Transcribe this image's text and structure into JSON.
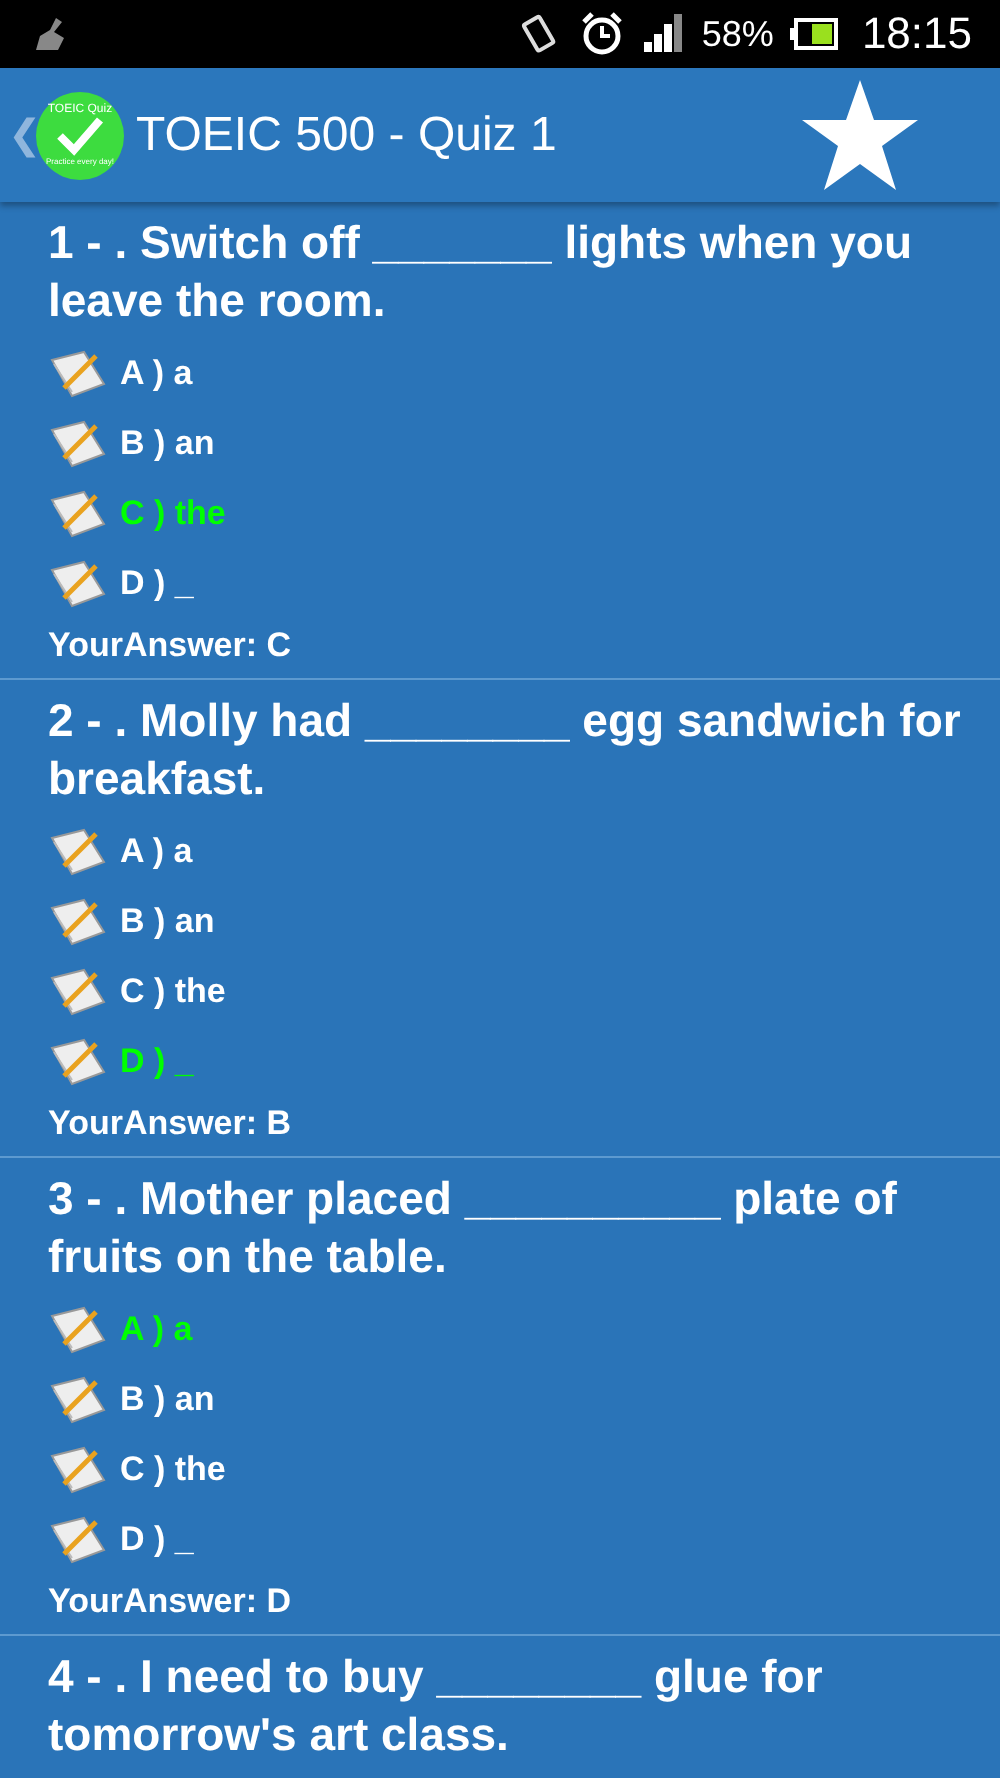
{
  "status_bar": {
    "battery": "58%",
    "time": "18:15"
  },
  "app_bar": {
    "back": "❮",
    "logo_title": "TOEIC Quiz",
    "logo_tagline": "Practice every day!",
    "title": "TOEIC 500 - Quiz 1"
  },
  "questions": [
    {
      "text": "1 - . Switch off _______ lights when you leave the room.",
      "options": [
        {
          "label": "A ) a",
          "correct": false
        },
        {
          "label": "B ) an",
          "correct": false
        },
        {
          "label": "C ) the",
          "correct": true
        },
        {
          "label": "D ) _",
          "correct": false
        }
      ],
      "your_answer": "YourAnswer: C"
    },
    {
      "text": "2 - . Molly had ________ egg sandwich for breakfast.",
      "options": [
        {
          "label": "A ) a",
          "correct": false
        },
        {
          "label": "B ) an",
          "correct": false
        },
        {
          "label": "C ) the",
          "correct": false
        },
        {
          "label": "D ) _",
          "correct": true
        }
      ],
      "your_answer": "YourAnswer: B"
    },
    {
      "text": "3 - . Mother placed __________ plate of fruits on the table.",
      "options": [
        {
          "label": "A ) a",
          "correct": true
        },
        {
          "label": "B ) an",
          "correct": false
        },
        {
          "label": "C ) the",
          "correct": false
        },
        {
          "label": "D ) _",
          "correct": false
        }
      ],
      "your_answer": "YourAnswer: D"
    },
    {
      "text": "4 - . I need to buy ________ glue for tomorrow's art class."
    }
  ]
}
